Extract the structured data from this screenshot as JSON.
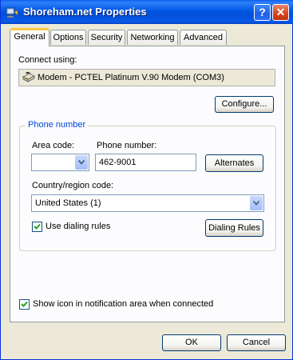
{
  "window": {
    "title": "Shoreham.net Properties",
    "help_label": "?",
    "close_label": "✕"
  },
  "tabs": [
    "General",
    "Options",
    "Security",
    "Networking",
    "Advanced"
  ],
  "general": {
    "connect_using_label": "Connect using:",
    "device_name": "Modem - PCTEL Platinum V.90 Modem (COM3)",
    "configure_label": "Configure...",
    "phone_group_title": "Phone number",
    "area_code_label": "Area code:",
    "area_code_value": "",
    "phone_number_label": "Phone number:",
    "phone_number_value": "462-9001",
    "alternates_label": "Alternates",
    "country_label": "Country/region code:",
    "country_value": "United States (1)",
    "use_dialing_rules_label": "Use dialing rules",
    "use_dialing_rules_checked": true,
    "dialing_rules_label": "Dialing Rules",
    "show_icon_label": "Show icon in notification area when connected",
    "show_icon_checked": true
  },
  "footer": {
    "ok_label": "OK",
    "cancel_label": "Cancel"
  }
}
